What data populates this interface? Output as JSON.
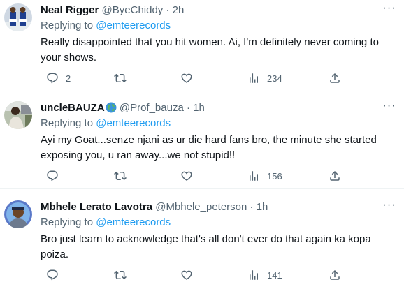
{
  "replies": [
    {
      "name": "Neal Rigger",
      "handle": "@ByeChiddy",
      "time": "2h",
      "replying_prefix": "Replying to ",
      "replying_to": "@emteerecords",
      "text": "Really disappointed that you hit women. Ai, I'm definitely never coming to your shows.",
      "reply_count": "2",
      "retweet_count": "",
      "like_count": "",
      "view_count": "234"
    },
    {
      "name": "uncleBAUZA",
      "handle": "@Prof_bauza",
      "time": "1h",
      "replying_prefix": "Replying to ",
      "replying_to": "@emteerecords",
      "text": "Ayi my Goat...senze njani as ur die hard fans bro, the minute she started exposing you, u ran away...we not stupid!!",
      "reply_count": "",
      "retweet_count": "",
      "like_count": "",
      "view_count": "156"
    },
    {
      "name": "Mbhele Lerato Lavotra",
      "handle": "@Mbhele_peterson",
      "time": "1h",
      "replying_prefix": "Replying to ",
      "replying_to": "@emteerecords",
      "text": "Bro just learn to acknowledge that's all don't ever do that again ka kopa poiza.",
      "reply_count": "",
      "retweet_count": "",
      "like_count": "",
      "view_count": "141"
    }
  ],
  "separator": "·",
  "more_label": "···",
  "icons": {
    "reply": "reply-icon",
    "retweet": "retweet-icon",
    "like": "like-icon",
    "views": "views-icon",
    "share": "share-icon",
    "badge": "globe-icon"
  },
  "colors": {
    "link": "#1d9bf0",
    "secondary": "#536471",
    "text": "#0f1419",
    "divider": "#eff3f4"
  }
}
